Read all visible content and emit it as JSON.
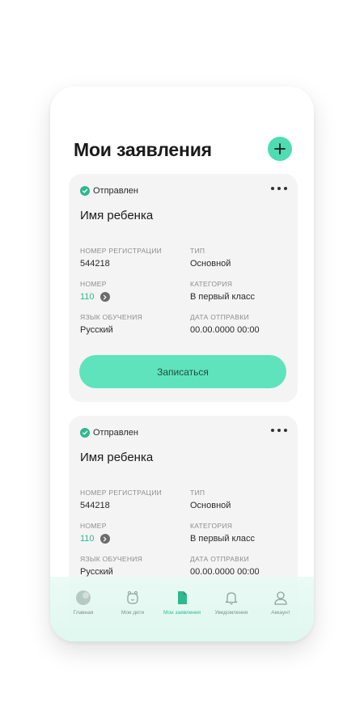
{
  "header": {
    "title": "Мои заявления"
  },
  "cards": [
    {
      "status": "Отправлен",
      "child_name": "Имя ребенка",
      "reg_number_label": "НОМЕР РЕГИСТРАЦИИ",
      "reg_number": "544218",
      "type_label": "ТИП",
      "type": "Основной",
      "number_label": "НОМЕР",
      "number": "110",
      "category_label": "КАТЕГОРИЯ",
      "category": "В первый класс",
      "language_label": "ЯЗЫК ОБУЧЕНИЯ",
      "language": "Русский",
      "sent_date_label": "ДАТА ОТПРАВКИ",
      "sent_date": "00.00.0000 00:00",
      "button": "Записаться"
    },
    {
      "status": "Отправлен",
      "child_name": "Имя ребенка",
      "reg_number_label": "НОМЕР РЕГИСТРАЦИИ",
      "reg_number": "544218",
      "type_label": "ТИП",
      "type": "Основной",
      "number_label": "НОМЕР",
      "number": "110",
      "category_label": "КАТЕГОРИЯ",
      "category": "В первый класс",
      "language_label": "ЯЗЫК ОБУЧЕНИЯ",
      "language": "Русский",
      "sent_date_label": "ДАТА ОТПРАВКИ",
      "sent_date": "00.00.0000 00:00"
    }
  ],
  "tabs": [
    {
      "label": "Главная",
      "icon": "home-icon"
    },
    {
      "label": "Мои дети",
      "icon": "children-icon"
    },
    {
      "label": "Мои заявления",
      "icon": "document-icon",
      "active": true
    },
    {
      "label": "Уведомления",
      "icon": "bell-icon"
    },
    {
      "label": "Аккаунт",
      "icon": "account-icon"
    }
  ],
  "colors": {
    "accent": "#4fdcb2",
    "accent_dark": "#2fb88f",
    "card_bg": "#f4f4f4",
    "tabbar_bg": "#dff8ef"
  }
}
